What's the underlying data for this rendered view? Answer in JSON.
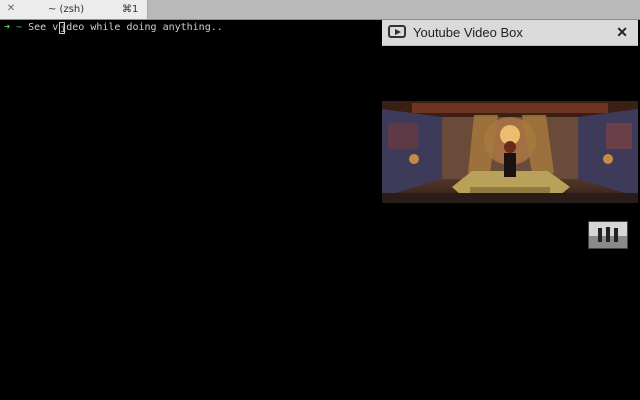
{
  "tabbar": {
    "tabs": [
      {
        "close_glyph": "✕",
        "title": "~ (zsh)",
        "shortcut": "⌘1"
      }
    ]
  },
  "terminal": {
    "prompt_arrow": "➜",
    "prompt_dir": "~",
    "command_before_cursor": "See v",
    "cursor_char": "i",
    "command_after_cursor": "deo while doing anything.."
  },
  "video_box": {
    "icon": "youtube-play-icon",
    "title": "Youtube Video Box",
    "close_glyph": "✕"
  },
  "colors": {
    "terminal_bg": "#000000",
    "prompt_arrow": "#5ad65a",
    "prompt_dir": "#57b6c9",
    "popup_header": "#dadada"
  }
}
